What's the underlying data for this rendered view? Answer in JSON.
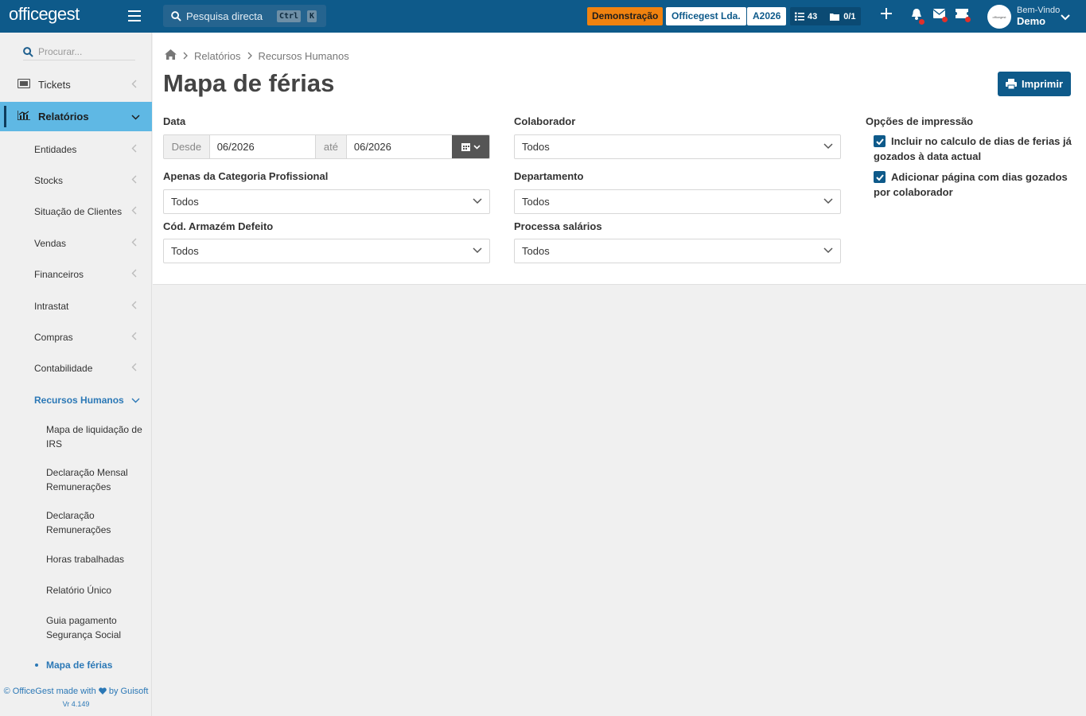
{
  "topbar": {
    "logo": "officegest",
    "search_label": "Pesquisa directa",
    "kbd_ctrl": "Ctrl",
    "kbd_k": "K",
    "demo_badge": "Demonstração",
    "company": "Officegest Lda.",
    "year": "A2026",
    "tasks_count": "43",
    "docs_count": "0/1",
    "welcome": "Bem-Vindo",
    "user": "Demo"
  },
  "sidebar": {
    "search_placeholder": "Procurar...",
    "top_items": [
      {
        "label": "Tickets",
        "icon": "ticket-icon"
      },
      {
        "label": "Relatórios",
        "icon": "chart-icon"
      }
    ],
    "sub_items": [
      "Entidades",
      "Stocks",
      "Situação de Clientes",
      "Vendas",
      "Financeiros",
      "Intrastat",
      "Compras",
      "Contabilidade",
      "Recursos Humanos"
    ],
    "leaves": [
      "Mapa de liquidação de IRS",
      "Declaração Mensal Remunerações",
      "Declaração Remunerações",
      "Horas trabalhadas",
      "Relatório Único",
      "Guia pagamento Segurança Social",
      "Mapa de férias"
    ],
    "footer_prefix": "© OfficeGest made with",
    "footer_suffix": "by Guisoft",
    "version": "Vr 4.149"
  },
  "breadcrumb": [
    "Relatórios",
    "Recursos Humanos"
  ],
  "page_title": "Mapa de férias",
  "print_button": "Imprimir",
  "form": {
    "data_label": "Data",
    "desde": "Desde",
    "desde_value": "06/2026",
    "ate": "até",
    "ate_value": "06/2026",
    "categoria_label": "Apenas da Categoria Profissional",
    "categoria_value": "Todos",
    "armazem_label": "Cód. Armazém Defeito",
    "armazem_value": "Todos",
    "colaborador_label": "Colaborador",
    "colaborador_value": "Todos",
    "departamento_label": "Departamento",
    "departamento_value": "Todos",
    "salarios_label": "Processa salários",
    "salarios_value": "Todos",
    "print_options_label": "Opções de impressão",
    "option1": "Incluir no calculo de dias de ferias já gozados à data actual",
    "option2": "Adicionar página com dias gozados por colaborador"
  },
  "colors": {
    "primary": "#0e5a8a",
    "accent": "#5fb8e4",
    "demo": "#f0820f",
    "link": "#2b78b6"
  }
}
